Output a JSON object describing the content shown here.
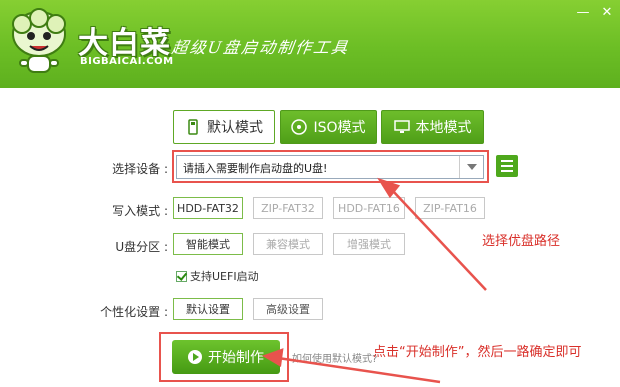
{
  "header": {
    "brand_name": "大白菜",
    "brand_url": "BIGBAICAI.COM",
    "slogan": "超级U盘启动制作工具",
    "minimize_symbol": "—",
    "close_symbol": "✕"
  },
  "tabs": [
    {
      "label": "默认模式",
      "icon": "usb-drive-icon",
      "active": true
    },
    {
      "label": "ISO模式",
      "icon": "disc-icon",
      "active": false
    },
    {
      "label": "本地模式",
      "icon": "monitor-icon",
      "active": false
    }
  ],
  "device": {
    "label": "选择设备 :",
    "value": "请插入需要制作启动盘的U盘!"
  },
  "write_mode": {
    "label": "写入模式 :",
    "options": [
      "HDD-FAT32",
      "ZIP-FAT32",
      "HDD-FAT16",
      "ZIP-FAT16"
    ],
    "selected": "HDD-FAT32"
  },
  "partition": {
    "label": "U盘分区 :",
    "options": [
      "智能模式",
      "兼容模式",
      "增强模式"
    ],
    "selected": "智能模式",
    "uefi_label": "支持UEFI启动"
  },
  "personalize": {
    "label": "个性化设置 :",
    "options": [
      "默认设置",
      "高级设置"
    ],
    "selected": "默认设置"
  },
  "start": {
    "label": "开始制作",
    "help_link": "如何使用默认模式?"
  },
  "annotations": {
    "device_note": "选择优盘路径",
    "start_note": "点击“开始制作”，然后一路确定即可",
    "color": "#e8534d"
  },
  "colors": {
    "brand_green": "#6cbe25",
    "button_green": "#4ea81c"
  }
}
